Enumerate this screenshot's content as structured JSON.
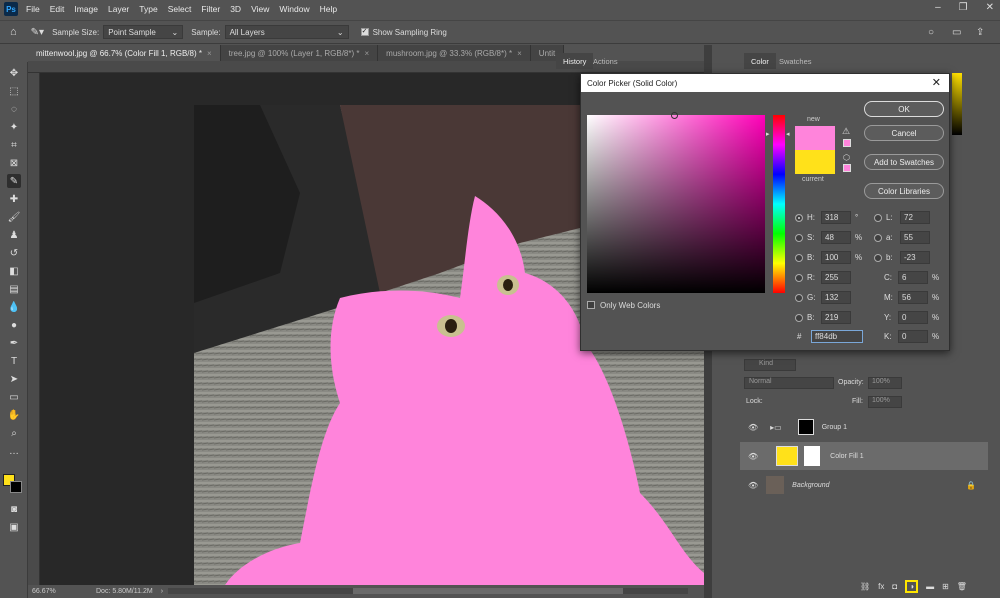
{
  "app": {
    "logo": "Ps",
    "menu": [
      "File",
      "Edit",
      "Image",
      "Layer",
      "Type",
      "Select",
      "Filter",
      "3D",
      "View",
      "Window",
      "Help"
    ]
  },
  "options_bar": {
    "sample_size_label": "Sample Size:",
    "sample_size_value": "Point Sample",
    "sample_label": "Sample:",
    "sample_value": "All Layers",
    "show_ring_label": "Show Sampling Ring",
    "show_ring_checked": true
  },
  "doc_tabs": [
    {
      "label": "mittenwool.jpg @ 66.7% (Color Fill 1, RGB/8) *",
      "active": true
    },
    {
      "label": "tree.jpg @ 100% (Layer 1, RGB/8*) *",
      "active": false
    },
    {
      "label": "mushroom.jpg @ 33.3% (RGB/8*) *",
      "active": false
    },
    {
      "label": "Untit",
      "active": false
    }
  ],
  "status_bar": {
    "zoom": "66.67%",
    "doc": "Doc: 5.80M/11.2M"
  },
  "panels": {
    "history_tabs": [
      "History",
      "Actions"
    ],
    "color_tabs": [
      "Color",
      "Swatches"
    ]
  },
  "color_picker": {
    "title": "Color Picker (Solid Color)",
    "new_label": "new",
    "current_label": "current",
    "new_color": "#ff84db",
    "current_color": "#ffe11a",
    "buttons": {
      "ok": "OK",
      "cancel": "Cancel",
      "add_swatches": "Add to Swatches",
      "color_libraries": "Color Libraries"
    },
    "only_web_colors": "Only Web Colors",
    "fields": {
      "H": {
        "label": "H:",
        "value": "318",
        "unit": "°"
      },
      "S": {
        "label": "S:",
        "value": "48",
        "unit": "%"
      },
      "B": {
        "label": "B:",
        "value": "100",
        "unit": "%"
      },
      "R": {
        "label": "R:",
        "value": "255",
        "unit": ""
      },
      "G": {
        "label": "G:",
        "value": "132",
        "unit": ""
      },
      "Bl": {
        "label": "B:",
        "value": "219",
        "unit": ""
      },
      "L": {
        "label": "L:",
        "value": "72",
        "unit": ""
      },
      "a": {
        "label": "a:",
        "value": "55",
        "unit": ""
      },
      "b": {
        "label": "b:",
        "value": "-23",
        "unit": ""
      },
      "C": {
        "label": "C:",
        "value": "6",
        "unit": "%"
      },
      "M": {
        "label": "M:",
        "value": "56",
        "unit": "%"
      },
      "Y": {
        "label": "Y:",
        "value": "0",
        "unit": "%"
      },
      "K": {
        "label": "K:",
        "value": "0",
        "unit": "%"
      }
    },
    "hex_label": "#",
    "hex_value": "ff84db"
  },
  "layers": {
    "kind_placeholder": "Kind",
    "blend_mode": "Normal",
    "opacity_label": "Opacity:",
    "opacity_value": "100%",
    "lock_label": "Lock:",
    "fill_label": "Fill:",
    "fill_value": "100%",
    "items": [
      {
        "name": "Group 1",
        "type": "group"
      },
      {
        "name": "Color Fill 1",
        "type": "fill"
      },
      {
        "name": "Background",
        "type": "background"
      }
    ]
  },
  "colors": {
    "foreground": "#ffe11a",
    "pink": "#ff84db",
    "accent_highlight": "#ffe600"
  }
}
